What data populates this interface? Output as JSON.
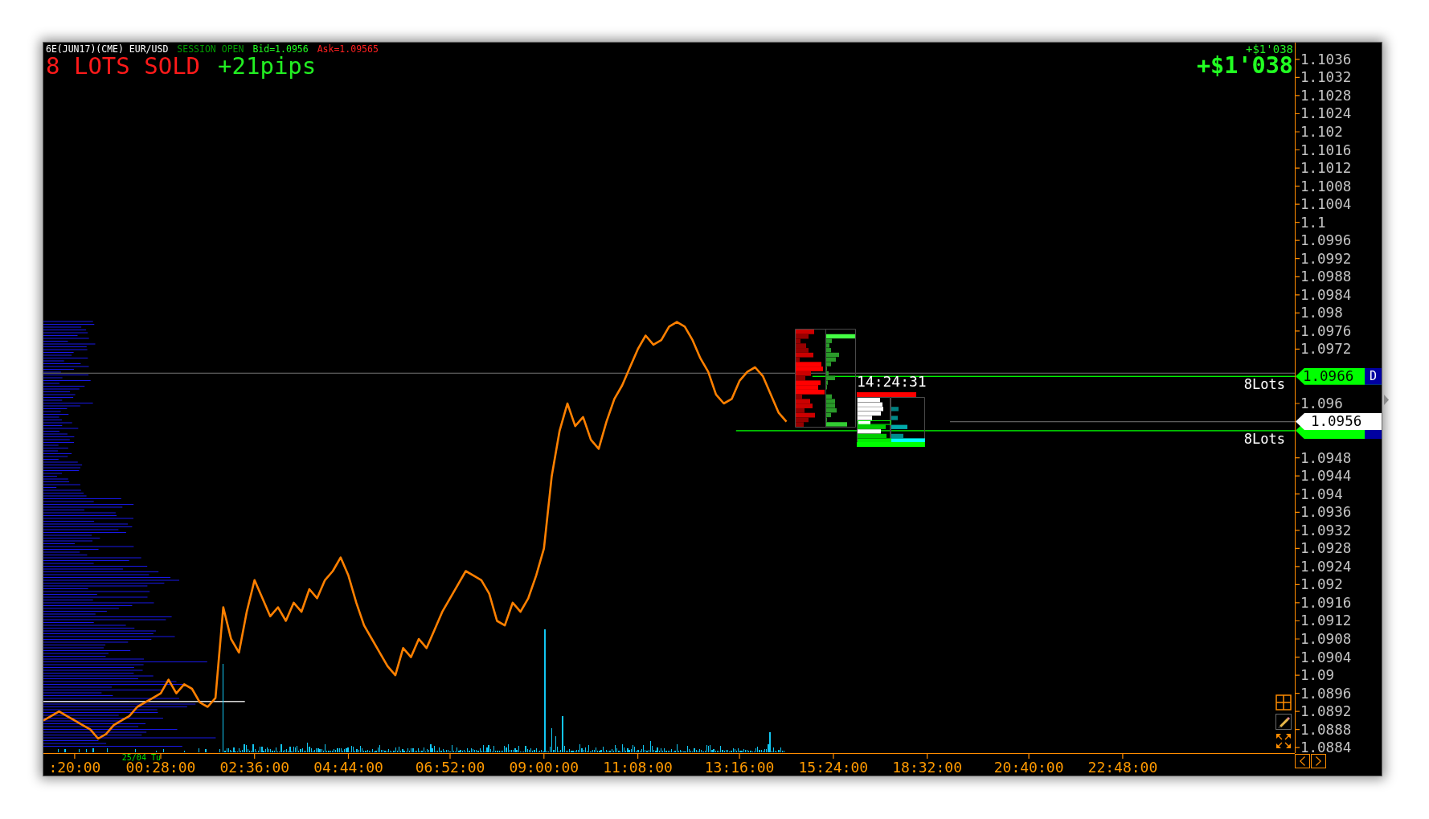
{
  "header": {
    "symbol": "6E(JUN17)(CME) EUR/USD",
    "session": "SESSION OPEN",
    "bid": "Bid=1.0956",
    "ask": "Ask=1.09565",
    "trade_status": "8 LOTS SOLD",
    "pips": "+21pips"
  },
  "pnl": {
    "caption": "+$1'038",
    "value": "+$1'038"
  },
  "order_flow": {
    "time": "14:24:31"
  },
  "chart_data": {
    "type": "line",
    "categories": [
      null,
      null,
      null,
      null,
      ":20:00",
      null,
      null,
      null,
      null,
      null,
      null,
      null,
      null,
      null,
      null,
      "00:28:00",
      null,
      null,
      null,
      null,
      null,
      null,
      null,
      null,
      null,
      null,
      null,
      "02:36:00",
      null,
      null,
      null,
      null,
      null,
      null,
      null,
      null,
      null,
      null,
      null,
      "04:44:00",
      null,
      null,
      null,
      null,
      null,
      null,
      null,
      null,
      null,
      null,
      null,
      null,
      "06:52:00",
      null,
      null,
      null,
      null,
      null,
      null,
      null,
      null,
      null,
      null,
      null,
      "09:00:00",
      null,
      null,
      null,
      null,
      null,
      null,
      null,
      null,
      null,
      null,
      null,
      "11:08:00",
      null,
      null,
      null,
      null,
      null,
      null,
      null,
      null,
      null,
      null,
      null,
      null,
      "13:16:00",
      null,
      null,
      null,
      null,
      null,
      null,
      null,
      null,
      null,
      null,
      null,
      "15:24:00",
      null,
      null,
      null,
      null,
      null,
      null,
      null,
      null,
      null,
      null,
      null,
      "18:32:00",
      null,
      null,
      null,
      null,
      null,
      null,
      null,
      null,
      null,
      null,
      null,
      null,
      "20:40:00",
      null,
      null,
      null,
      null,
      null,
      null,
      null,
      null,
      null,
      null,
      null,
      "22:48:00",
      null,
      null,
      null,
      null,
      null,
      null,
      null,
      null,
      null,
      null,
      null,
      null,
      null,
      null,
      null,
      null,
      null,
      null,
      null,
      null,
      null
    ],
    "ylim": [
      1.08828,
      1.10397
    ],
    "yticks": [
      {
        "value": 1.1036,
        "label": "1.1036"
      },
      {
        "value": 1.1032,
        "label": "1.1032"
      },
      {
        "value": 1.1028,
        "label": "1.1028"
      },
      {
        "value": 1.1024,
        "label": "1.1024"
      },
      {
        "value": 1.102,
        "label": "1.102"
      },
      {
        "value": 1.1016,
        "label": "1.1016"
      },
      {
        "value": 1.1012,
        "label": "1.1012"
      },
      {
        "value": 1.1008,
        "label": "1.1008"
      },
      {
        "value": 1.1004,
        "label": "1.1004"
      },
      {
        "value": 1.1,
        "label": "1.1"
      },
      {
        "value": 1.0996,
        "label": "1.0996"
      },
      {
        "value": 1.0992,
        "label": "1.0992"
      },
      {
        "value": 1.0988,
        "label": "1.0988"
      },
      {
        "value": 1.0984,
        "label": "1.0984"
      },
      {
        "value": 1.098,
        "label": "1.098"
      },
      {
        "value": 1.0976,
        "label": "1.0976"
      },
      {
        "value": 1.0972,
        "label": "1.0972"
      },
      {
        "value": 1.096,
        "label": "1.096"
      },
      {
        "value": 1.0948,
        "label": "1.0948"
      },
      {
        "value": 1.0944,
        "label": "1.0944"
      },
      {
        "value": 1.094,
        "label": "1.094"
      },
      {
        "value": 1.0936,
        "label": "1.0936"
      },
      {
        "value": 1.0932,
        "label": "1.0932"
      },
      {
        "value": 1.0928,
        "label": "1.0928"
      },
      {
        "value": 1.0924,
        "label": "1.0924"
      },
      {
        "value": 1.092,
        "label": "1.092"
      },
      {
        "value": 1.0916,
        "label": "1.0916"
      },
      {
        "value": 1.0912,
        "label": "1.0912"
      },
      {
        "value": 1.0908,
        "label": "1.0908"
      },
      {
        "value": 1.0904,
        "label": "1.0904"
      },
      {
        "value": 1.09,
        "label": "1.09"
      },
      {
        "value": 1.0896,
        "label": "1.0896"
      },
      {
        "value": 1.0892,
        "label": "1.0892"
      },
      {
        "value": 1.0888,
        "label": "1.0888"
      },
      {
        "value": 1.0884,
        "label": "1.0884"
      }
    ],
    "series": [
      {
        "color": "#ff8000",
        "values": [
          1.089,
          1.0891,
          1.0892,
          1.0891,
          1.089,
          1.0889,
          1.0888,
          1.0886,
          1.0887,
          1.0889,
          1.089,
          1.0891,
          1.0893,
          1.0894,
          1.0895,
          1.0896,
          1.0899,
          1.0896,
          1.0898,
          1.0897,
          1.0894,
          1.0893,
          1.0895,
          1.0915,
          1.0908,
          1.0905,
          1.0914,
          1.0921,
          1.0917,
          1.0913,
          1.0915,
          1.0912,
          1.0916,
          1.0914,
          1.0919,
          1.0917,
          1.0921,
          1.0923,
          1.0926,
          1.0922,
          1.0916,
          1.0911,
          1.0908,
          1.0905,
          1.0902,
          1.09,
          1.0906,
          1.0904,
          1.0908,
          1.0906,
          1.091,
          1.0914,
          1.0917,
          1.092,
          1.0923,
          1.0922,
          1.0921,
          1.0918,
          1.0912,
          1.0911,
          1.0916,
          1.0914,
          1.0917,
          1.0922,
          1.0928,
          1.0944,
          1.0954,
          1.096,
          1.0955,
          1.0957,
          1.0952,
          1.095,
          1.0956,
          1.0961,
          1.0964,
          1.0968,
          1.0972,
          1.0975,
          1.0973,
          1.0974,
          1.0977,
          1.0978,
          1.0977,
          1.0974,
          1.097,
          1.0967,
          1.0962,
          1.096,
          1.0961,
          1.0965,
          1.0967,
          1.0968,
          1.0966,
          1.0962,
          1.0958,
          1.0956,
          null,
          null,
          null,
          null,
          null,
          null,
          null,
          null,
          null,
          null,
          null,
          null,
          null,
          null,
          null,
          null,
          null,
          null,
          null,
          null,
          null,
          null,
          null,
          null,
          null,
          null,
          null,
          null,
          null,
          null,
          null,
          null,
          null,
          null,
          null,
          null,
          null,
          null,
          null,
          null,
          null,
          null,
          null,
          null,
          null,
          null,
          null,
          null,
          null,
          null,
          null,
          null,
          null,
          null,
          null,
          null,
          null,
          null,
          null,
          null,
          null,
          null,
          null,
          null
        ]
      }
    ],
    "ref_lines": [
      {
        "axis": "y",
        "value": 1.09667,
        "color": "#5c5c5c"
      },
      {
        "axis": "y",
        "value": 1.0966,
        "color": "#00ff00"
      },
      {
        "axis": "y",
        "value": 1.0956,
        "color": "#5c5c5c"
      },
      {
        "axis": "y",
        "value": 1.0954,
        "color": "#00ff00"
      },
      {
        "axis": "y",
        "value": 1.08942,
        "color": "#ffffff"
      }
    ],
    "annotations": [
      "8Lots",
      "8Lots"
    ]
  },
  "price_tags": [
    {
      "kind": "position",
      "text": "1.0966",
      "badge": "D"
    },
    {
      "kind": "bid",
      "text": "1.0956"
    },
    {
      "kind": "position"
    }
  ],
  "date_label": "25/04 Tu"
}
